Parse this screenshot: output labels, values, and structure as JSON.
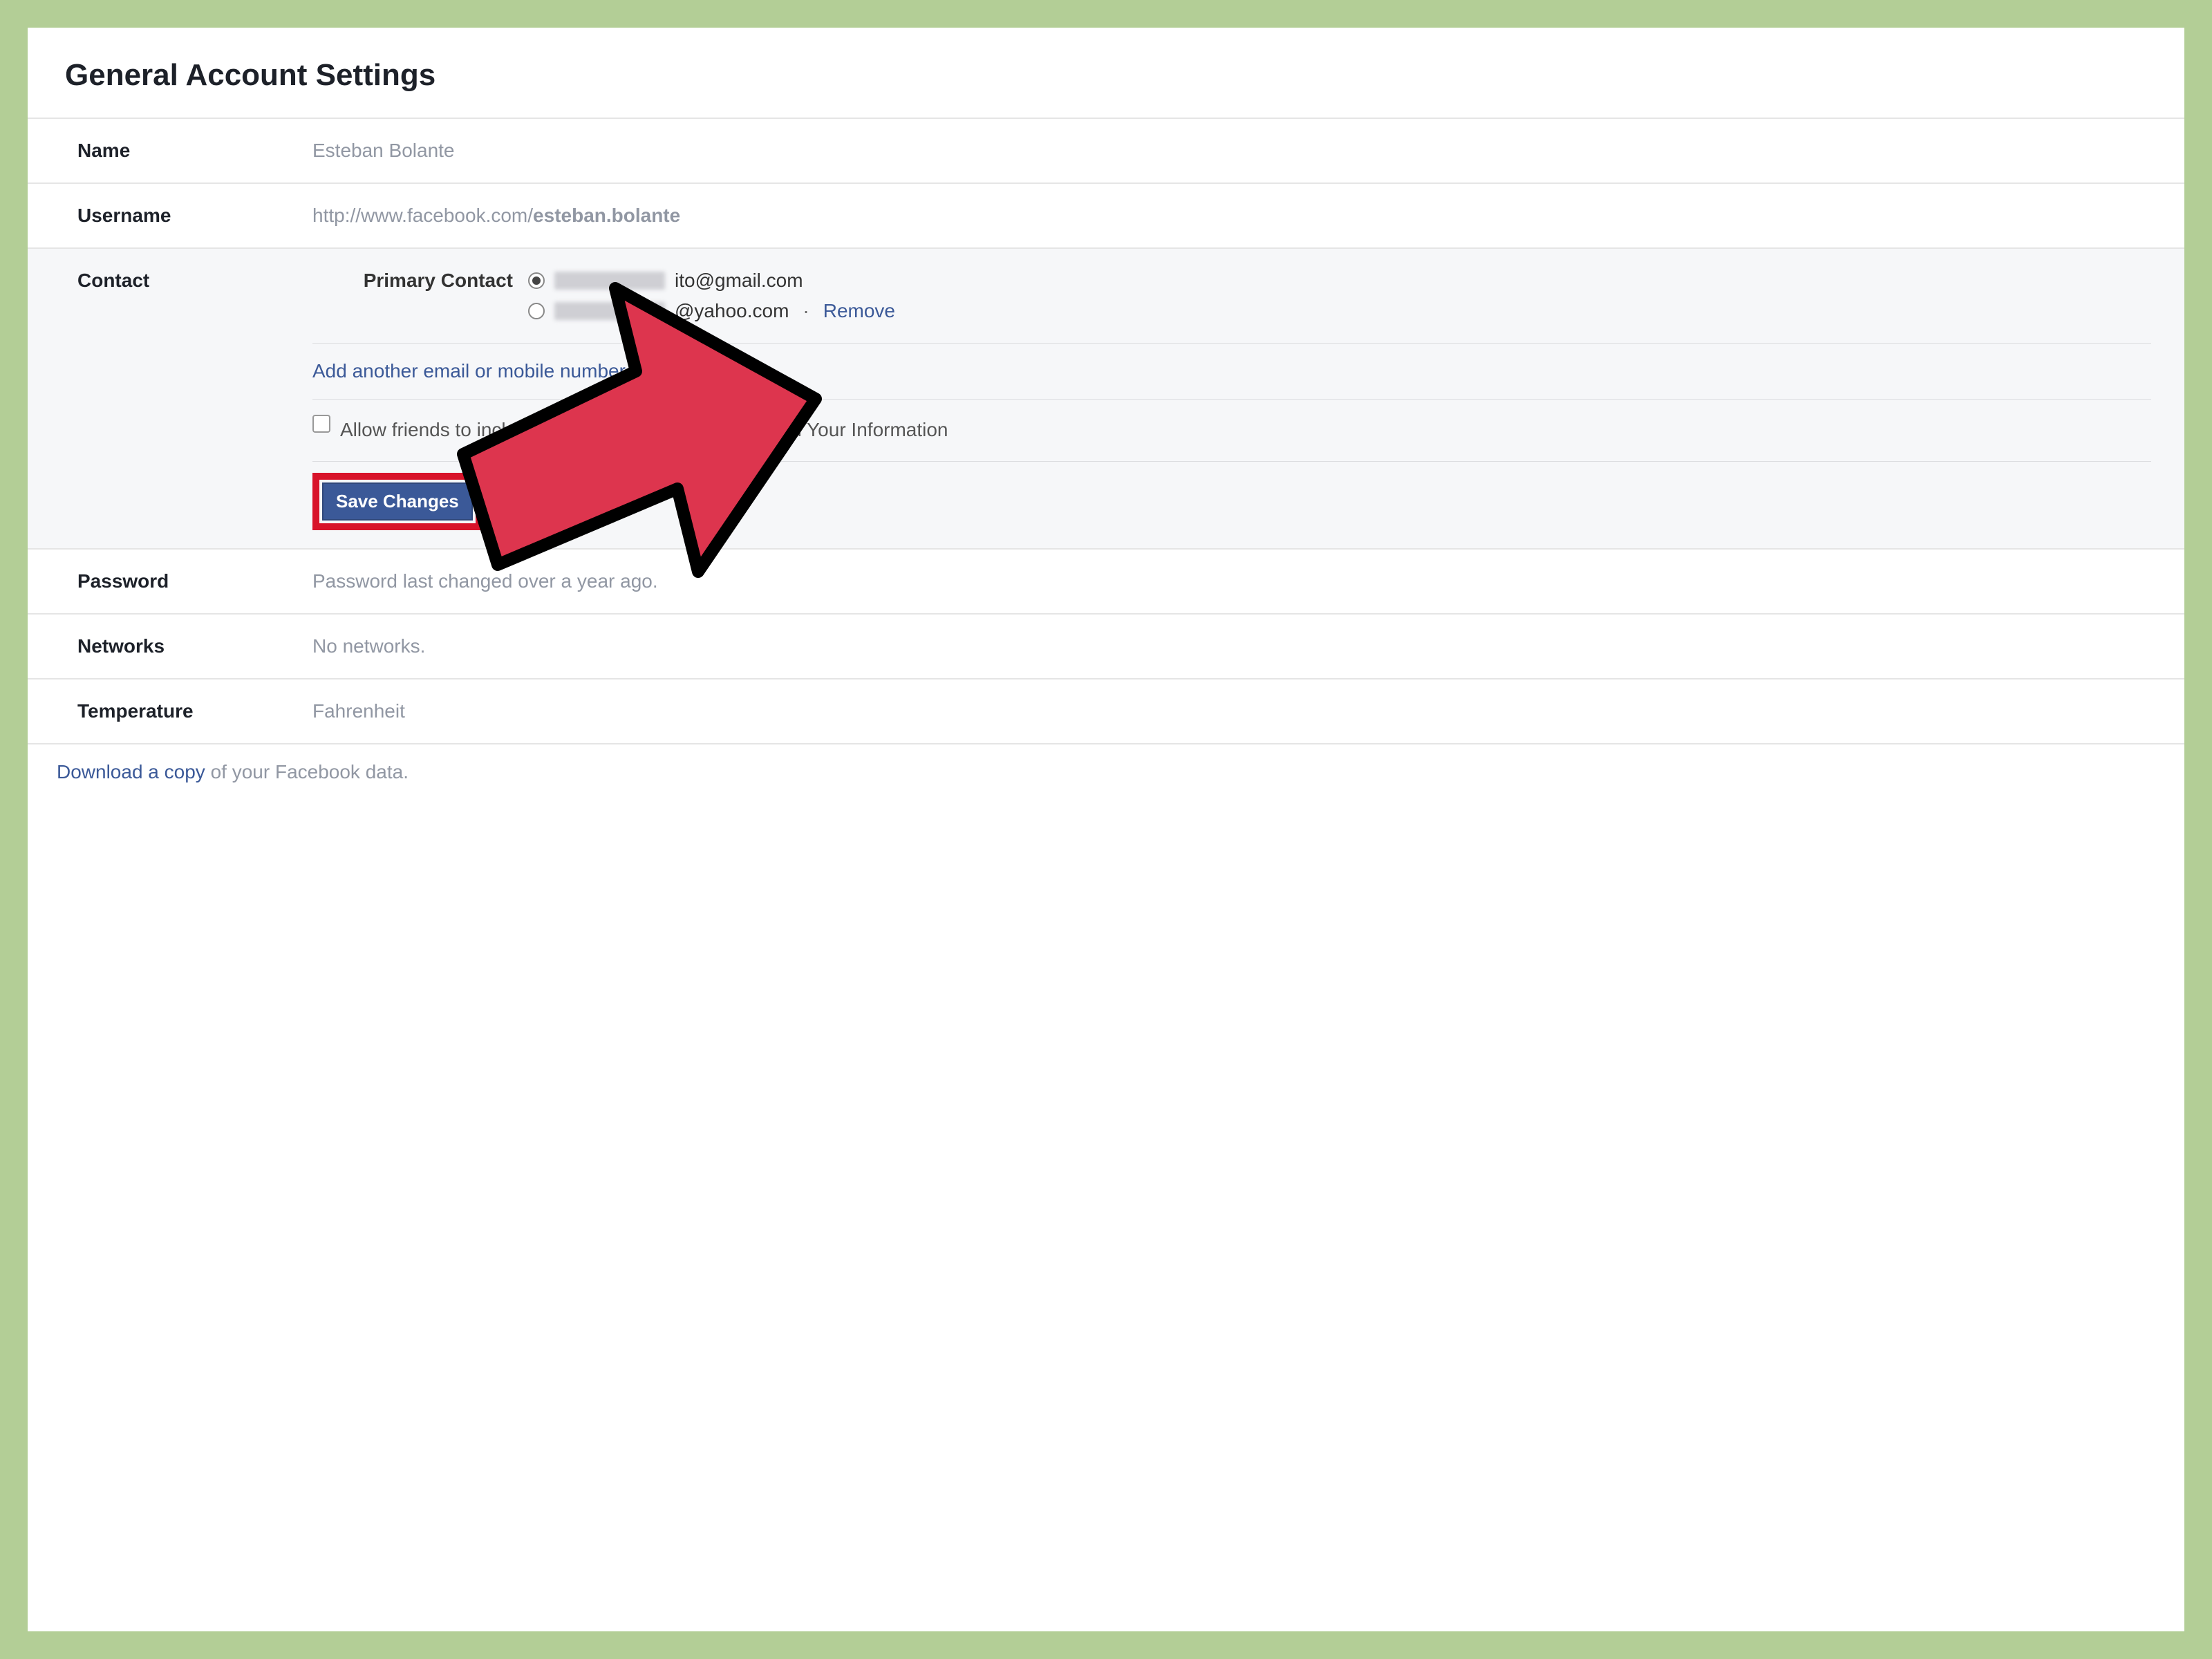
{
  "page": {
    "title": "General Account Settings"
  },
  "rows": {
    "name": {
      "label": "Name",
      "value": "Esteban Bolante"
    },
    "username": {
      "label": "Username",
      "url_prefix": "http://www.facebook.com/",
      "url_user": "esteban.bolante"
    },
    "password": {
      "label": "Password",
      "value": "Password last changed over a year ago."
    },
    "networks": {
      "label": "Networks",
      "value": "No networks."
    },
    "temperature": {
      "label": "Temperature",
      "value": "Fahrenheit"
    }
  },
  "contact": {
    "label": "Contact",
    "primary_label": "Primary Contact",
    "emails": [
      {
        "suffix": "ito@gmail.com",
        "selected": true,
        "removable": false
      },
      {
        "suffix": "@yahoo.com",
        "selected": false,
        "removable": true
      }
    ],
    "remove_label": "Remove",
    "add_link": "Add another email or mobile number",
    "allow_text_a": "Allow friends to include my ema",
    "allow_text_b": "nload Your Information",
    "save_label": "Save Changes"
  },
  "footer": {
    "link_text": "Download a copy",
    "rest_text": " of your Facebook data."
  },
  "colors": {
    "accent": "#3b5998",
    "highlight": "#d8132a",
    "arrow_fill": "#dd354e"
  }
}
